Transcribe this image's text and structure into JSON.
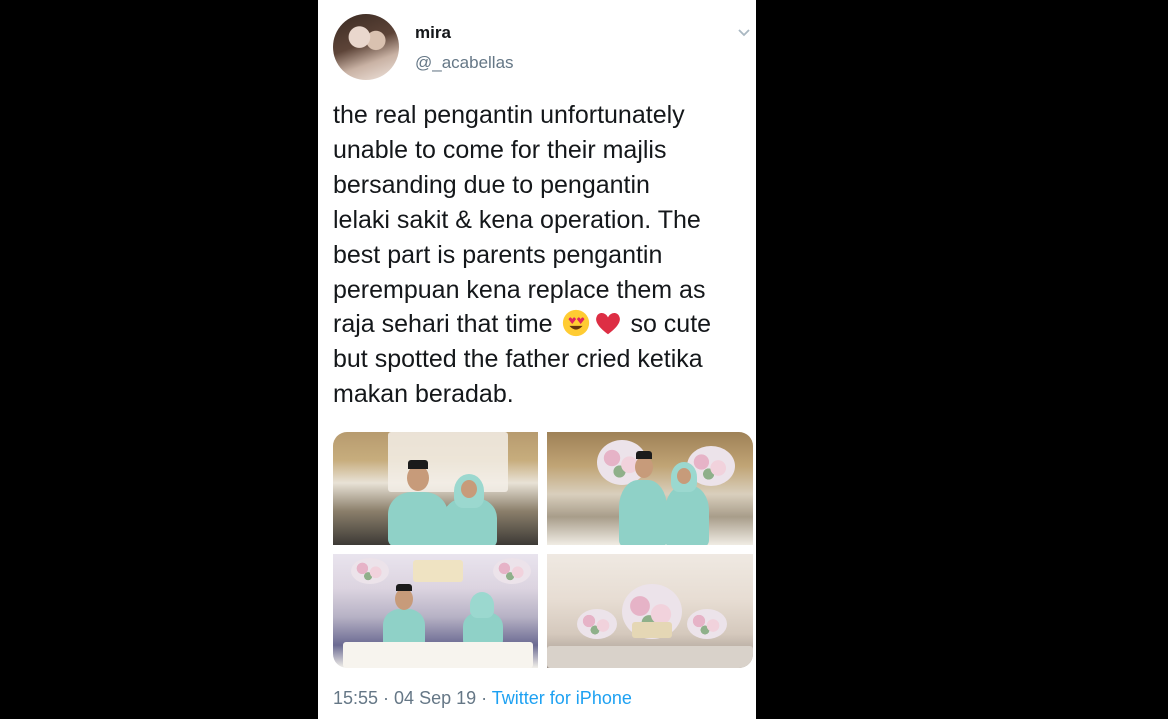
{
  "user": {
    "display_name": "mira",
    "handle": "@_acabellas",
    "avatar_icon": "profile-avatar"
  },
  "tweet": {
    "lines": [
      "the real pengantin unfortunately",
      "unable to come for their majlis",
      "bersanding due to pengantin",
      "lelaki sakit & kena operation. The",
      "best part is parents pengantin",
      "perempuan kena replace them as"
    ],
    "line7_before": "raja sehari that time ",
    "line7_after": " so cute",
    "line8": "but spotted the father cried ketika",
    "line9": "makan beradab.",
    "emojis": [
      "heart-eyes-emoji",
      "red-heart-emoji"
    ]
  },
  "media": {
    "photos": [
      "couple-standing-photo",
      "couple-at-table-photo",
      "couple-seated-photo",
      "wedding-stage-photo"
    ]
  },
  "meta": {
    "time": "15:55",
    "separator": " · ",
    "date": "04 Sep 19",
    "source": "Twitter for iPhone"
  },
  "colors": {
    "text": "#14171a",
    "secondary": "#657786",
    "link": "#1da1f2",
    "outfit": "#8fd1c7"
  }
}
